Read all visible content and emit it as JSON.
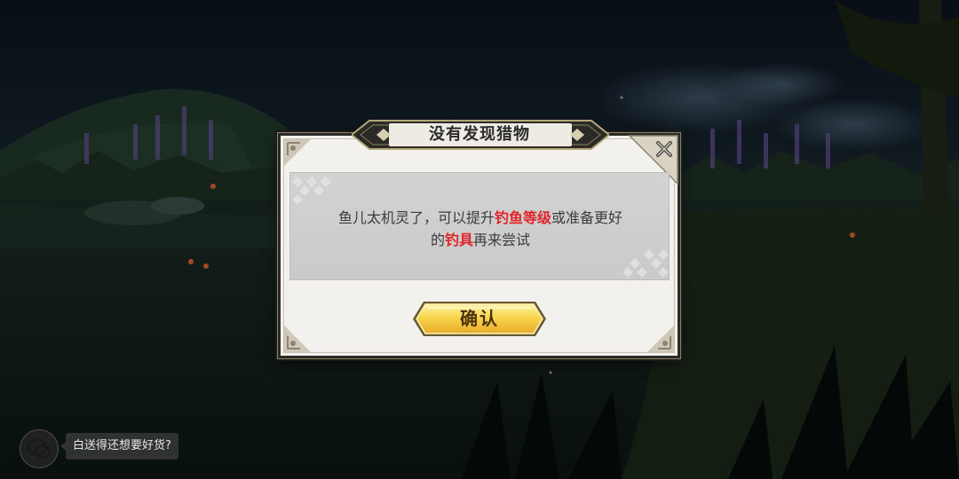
{
  "dialog": {
    "title": "没有发现猎物",
    "message": {
      "part1": "鱼儿太机灵了，可以提升",
      "highlight1": "钓鱼等级",
      "part2": "或准备更好",
      "part3": "的",
      "highlight2": "钓具",
      "part4": "再来尝试"
    },
    "confirm_label": "确认",
    "close_icon": "close-x-icon"
  },
  "chat": {
    "icon": "chat-bubble-icon",
    "message": "白送得还想要好货?"
  },
  "colors": {
    "highlight": "#e0252a",
    "button_gold": "#f7d34a",
    "dialog_bg": "#f3f1ee",
    "message_bg": "#cccccc"
  }
}
